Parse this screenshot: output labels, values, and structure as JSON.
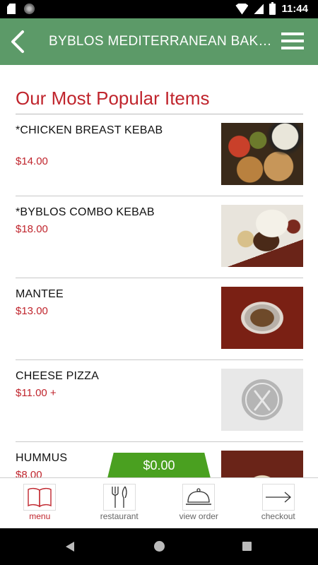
{
  "status_bar": {
    "time": "11:44"
  },
  "header": {
    "title": "BYBLOS MEDITERRANEAN BAKE..."
  },
  "main": {
    "section_title": "Our Most Popular Items",
    "items": [
      {
        "name": "*CHICKEN BREAST KEBAB",
        "price": "$14.00"
      },
      {
        "name": "*BYBLOS COMBO KEBAB",
        "price": "$18.00"
      },
      {
        "name": "MANTEE",
        "price": "$13.00"
      },
      {
        "name": "CHEESE PIZZA",
        "price": "$11.00 +"
      },
      {
        "name": "HUMMUS",
        "price": "$8.00"
      }
    ]
  },
  "order": {
    "total": "$0.00"
  },
  "tabs": [
    {
      "label": "menu",
      "icon": "book-icon",
      "active": true
    },
    {
      "label": "restaurant",
      "icon": "fork-knife-icon",
      "active": false
    },
    {
      "label": "view order",
      "icon": "cloche-icon",
      "active": false
    },
    {
      "label": "checkout",
      "icon": "arrow-right-icon",
      "active": false
    }
  ],
  "colors": {
    "header": "#5c9a68",
    "accent": "#c0252d",
    "order_button": "#4aa020"
  }
}
